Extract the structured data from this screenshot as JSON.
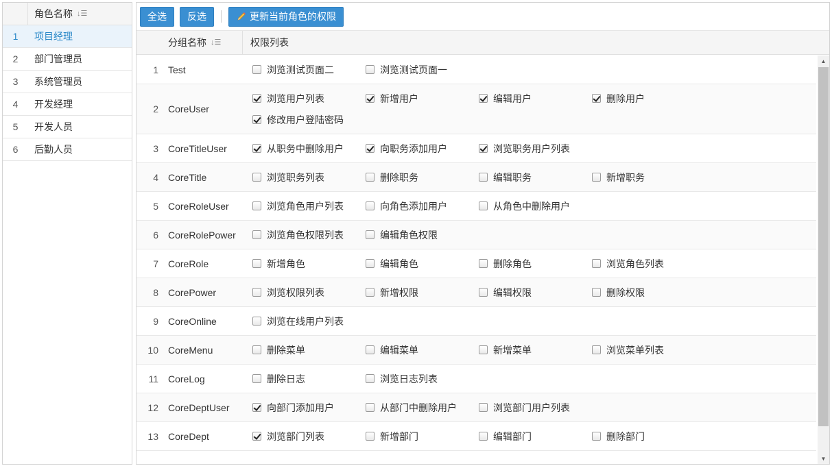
{
  "roles": {
    "header": "角色名称",
    "items": [
      {
        "num": "1",
        "name": "项目经理",
        "selected": true
      },
      {
        "num": "2",
        "name": "部门管理员",
        "selected": false
      },
      {
        "num": "3",
        "name": "系统管理员",
        "selected": false
      },
      {
        "num": "4",
        "name": "开发经理",
        "selected": false
      },
      {
        "num": "5",
        "name": "开发人员",
        "selected": false
      },
      {
        "num": "6",
        "name": "后勤人员",
        "selected": false
      }
    ]
  },
  "toolbar": {
    "select_all": "全选",
    "invert": "反选",
    "update": "更新当前角色的权限"
  },
  "grid": {
    "group_header": "分组名称",
    "perm_header": "权限列表",
    "rows": [
      {
        "num": "1",
        "group": "Test",
        "perms": [
          {
            "label": "浏览测试页面二",
            "checked": false
          },
          {
            "label": "浏览测试页面一",
            "checked": false
          }
        ]
      },
      {
        "num": "2",
        "group": "CoreUser",
        "perms": [
          {
            "label": "浏览用户列表",
            "checked": true
          },
          {
            "label": "新增用户",
            "checked": true
          },
          {
            "label": "编辑用户",
            "checked": true
          },
          {
            "label": "删除用户",
            "checked": true
          },
          {
            "label": "修改用户登陆密码",
            "checked": true
          }
        ]
      },
      {
        "num": "3",
        "group": "CoreTitleUser",
        "perms": [
          {
            "label": "从职务中删除用户",
            "checked": true
          },
          {
            "label": "向职务添加用户",
            "checked": true
          },
          {
            "label": "浏览职务用户列表",
            "checked": true
          }
        ]
      },
      {
        "num": "4",
        "group": "CoreTitle",
        "perms": [
          {
            "label": "浏览职务列表",
            "checked": false
          },
          {
            "label": "删除职务",
            "checked": false
          },
          {
            "label": "编辑职务",
            "checked": false
          },
          {
            "label": "新增职务",
            "checked": false
          }
        ]
      },
      {
        "num": "5",
        "group": "CoreRoleUser",
        "perms": [
          {
            "label": "浏览角色用户列表",
            "checked": false
          },
          {
            "label": "向角色添加用户",
            "checked": false
          },
          {
            "label": "从角色中删除用户",
            "checked": false
          }
        ]
      },
      {
        "num": "6",
        "group": "CoreRolePower",
        "perms": [
          {
            "label": "浏览角色权限列表",
            "checked": false
          },
          {
            "label": "编辑角色权限",
            "checked": false
          }
        ]
      },
      {
        "num": "7",
        "group": "CoreRole",
        "perms": [
          {
            "label": "新增角色",
            "checked": false
          },
          {
            "label": "编辑角色",
            "checked": false
          },
          {
            "label": "删除角色",
            "checked": false
          },
          {
            "label": "浏览角色列表",
            "checked": false
          }
        ]
      },
      {
        "num": "8",
        "group": "CorePower",
        "perms": [
          {
            "label": "浏览权限列表",
            "checked": false
          },
          {
            "label": "新增权限",
            "checked": false
          },
          {
            "label": "编辑权限",
            "checked": false
          },
          {
            "label": "删除权限",
            "checked": false
          }
        ]
      },
      {
        "num": "9",
        "group": "CoreOnline",
        "perms": [
          {
            "label": "浏览在线用户列表",
            "checked": false
          }
        ]
      },
      {
        "num": "10",
        "group": "CoreMenu",
        "perms": [
          {
            "label": "删除菜单",
            "checked": false
          },
          {
            "label": "编辑菜单",
            "checked": false
          },
          {
            "label": "新增菜单",
            "checked": false
          },
          {
            "label": "浏览菜单列表",
            "checked": false
          }
        ]
      },
      {
        "num": "11",
        "group": "CoreLog",
        "perms": [
          {
            "label": "删除日志",
            "checked": false
          },
          {
            "label": "浏览日志列表",
            "checked": false
          }
        ]
      },
      {
        "num": "12",
        "group": "CoreDeptUser",
        "perms": [
          {
            "label": "向部门添加用户",
            "checked": true
          },
          {
            "label": "从部门中删除用户",
            "checked": false
          },
          {
            "label": "浏览部门用户列表",
            "checked": false
          }
        ]
      },
      {
        "num": "13",
        "group": "CoreDept",
        "perms": [
          {
            "label": "浏览部门列表",
            "checked": true
          },
          {
            "label": "新增部门",
            "checked": false
          },
          {
            "label": "编辑部门",
            "checked": false
          },
          {
            "label": "删除部门",
            "checked": false
          }
        ]
      }
    ]
  },
  "scroll": {
    "thumb_fraction": 0.91,
    "position_fraction": 0
  }
}
